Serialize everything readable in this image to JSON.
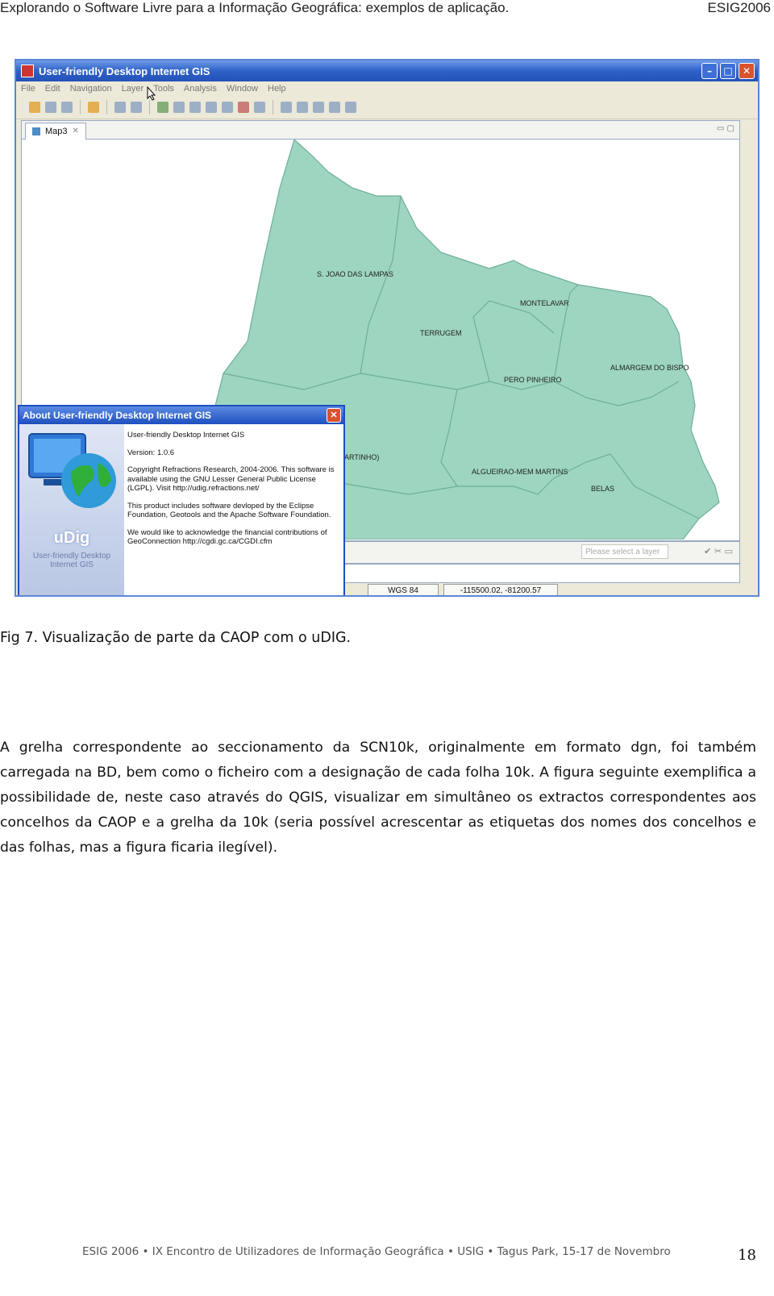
{
  "header": {
    "title": "Explorando o Software Livre para a Informação Geográfica: exemplos de aplicação.",
    "right": "ESIG2006"
  },
  "screenshot": {
    "window_title": "User-friendly Desktop Internet GIS",
    "menu": [
      "File",
      "Edit",
      "Navigation",
      "Layer",
      "Tools",
      "Analysis",
      "Window",
      "Help"
    ],
    "tab": "Map3",
    "layer_select_placeholder": "Please select a layer",
    "crs": "WGS 84",
    "coordinates": "-115500.02, -81200.57",
    "map_labels": [
      "S. JOAO DAS LAMPAS",
      "MONTELAVAR",
      "TERRUGEM",
      "ALMARGEM DO BISPO",
      "PERO PINHEIRO",
      "ARTINHO)",
      "ALGUEIRAO-MEM MARTINS",
      "BELAS"
    ],
    "colors": {
      "map_fill": "#9DD5C0",
      "map_border": "#6FAF98",
      "titlebar": "#2E61C7"
    },
    "about": {
      "title": "About User-friendly Desktop Internet GIS",
      "app_name": "User-friendly Desktop Internet GIS",
      "version": "Version: 1.0.6",
      "copyright": "Copyright Refractions Research, 2004-2006. This software is available using the GNU Lesser General Public License (LGPL). Visit http://udig.refractions.net/",
      "eclipse": "This product includes software devloped by the Eclipse Foundation, Geotools and the Apache Software Foundation.",
      "ack": "We would like to acknowledge the financial contributions of GeoConnection http://cgdi.gc.ca/CGDI.cfm",
      "logo": "uDig",
      "logo_caption": "User-friendly Desktop Internet GIS"
    }
  },
  "caption": "Fig 7. Visualização de parte da CAOP com o uDIG.",
  "paragraph": "A grelha correspondente ao seccionamento da SCN10k, originalmente em formato dgn, foi também carregada na BD, bem como o ficheiro com a designação de cada folha 10k. A figura seguinte exemplifica a possibilidade de, neste caso através do QGIS, visualizar em simultâneo os extractos correspondentes aos concelhos da CAOP e a grelha da 10k (seria possível acrescentar as etiquetas dos nomes dos concelhos e das folhas, mas a figura ficaria ilegível).",
  "footer": "ESIG 2006 • IX Encontro de Utilizadores de Informação Geográfica • USIG • Tagus Park, 15-17 de Novembro",
  "page_number": "18"
}
